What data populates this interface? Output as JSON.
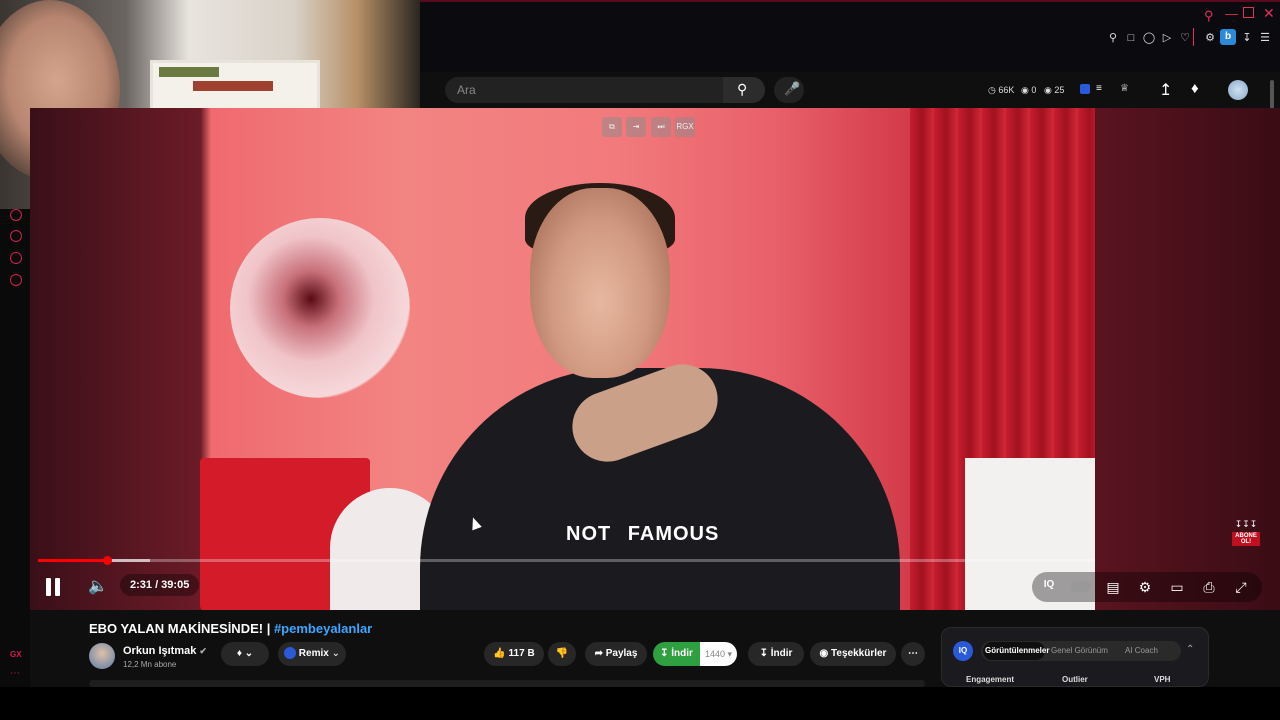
{
  "header": {
    "search_placeholder": "Ara",
    "stats": {
      "views_badge": "66K",
      "likes_badge": "0",
      "comments_badge": "25"
    }
  },
  "overlay": {
    "rgx_label": "RGX"
  },
  "player": {
    "time": "2:31 / 39:05",
    "progress_fraction": 0.065,
    "tshirt_text_left": "NOT",
    "tshirt_text_right": "FAMOUS",
    "abone_label": "ABONE OL!"
  },
  "video": {
    "title_main": "EBO YALAN MAKİNESİNDE! | ",
    "title_hashtag": "#pembeyalanlar",
    "channel_name": "Orkun Işıtmak",
    "subscribers": "12,2 Mn abone",
    "remix_label": "Remix",
    "likes": "117 B",
    "share_label": "Paylaş",
    "download_green_label": "İndir",
    "download_quality": "1440",
    "download_label": "İndir",
    "thanks_label": "Teşekkürler"
  },
  "analytics": {
    "logo": "IQ",
    "tabs": [
      "Görüntülenmeler",
      "Genel Görünüm",
      "AI Coach"
    ],
    "columns": [
      "Engagement",
      "Outlier",
      "VPH"
    ]
  },
  "sidebar": {
    "gx_label": "GX"
  },
  "colors": {
    "accent": "#e0305a",
    "progress": "#ff0000",
    "link": "#3ea6ff",
    "download_green": "#2ea040"
  }
}
